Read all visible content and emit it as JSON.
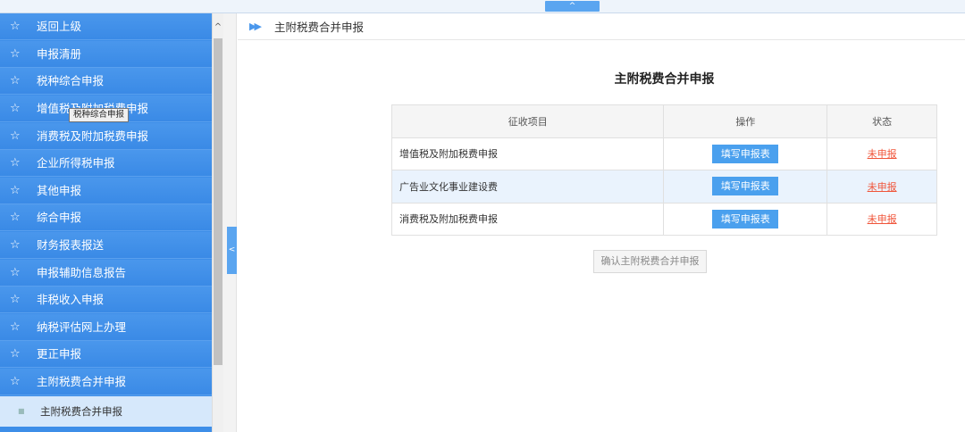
{
  "top_bar": {
    "collapse_glyph": "^"
  },
  "sidebar": {
    "items": [
      {
        "label": "返回上级"
      },
      {
        "label": "申报清册"
      },
      {
        "label": "税种综合申报"
      },
      {
        "label": "增值税及附加税费申报"
      },
      {
        "label": "消费税及附加税费申报"
      },
      {
        "label": "企业所得税申报"
      },
      {
        "label": "其他申报"
      },
      {
        "label": "综合申报"
      },
      {
        "label": "财务报表报送"
      },
      {
        "label": "申报辅助信息报告"
      },
      {
        "label": "非税收入申报"
      },
      {
        "label": "纳税评估网上办理"
      },
      {
        "label": "更正申报"
      },
      {
        "label": "主附税费合并申报"
      }
    ],
    "star_glyph": "☆",
    "sub_item": {
      "label": "主附税费合并申报",
      "dot": "■"
    },
    "tooltip": "税种综合申报"
  },
  "scrollbar": {
    "up_glyph": "^"
  },
  "splitter": {
    "glyph": "<"
  },
  "breadcrumb": {
    "icon": "▶▶",
    "text": "主附税费合并申报"
  },
  "main": {
    "title": "主附税费合并申报",
    "table": {
      "headers": [
        "征收项目",
        "操作",
        "状态"
      ],
      "rows": [
        {
          "item": "增值税及附加税费申报",
          "action": "填写申报表",
          "status": "未申报"
        },
        {
          "item": "广告业文化事业建设费",
          "action": "填写申报表",
          "status": "未申报"
        },
        {
          "item": "消费税及附加税费申报",
          "action": "填写申报表",
          "status": "未申报"
        }
      ]
    },
    "confirm_button": "确认主附税费合并申报"
  }
}
